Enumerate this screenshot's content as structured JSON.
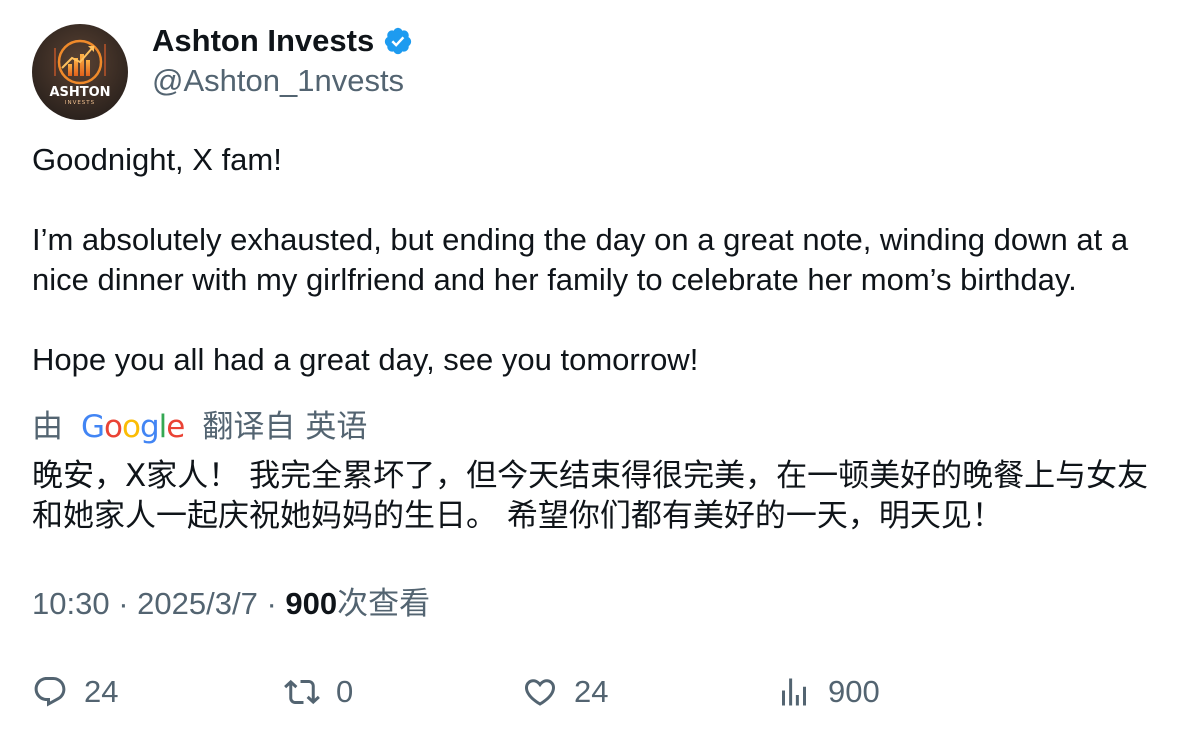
{
  "tweet": {
    "avatar": {
      "brand": "ASHTON",
      "sub": "INVESTS"
    },
    "display_name": "Ashton Invests",
    "handle": "@Ashton_1nvests",
    "verified_icon": "verified-badge-icon",
    "text_paragraphs": [
      "Goodnight, X fam!",
      "I’m absolutely exhausted, but ending the day on a great note, winding down at a nice dinner with my girlfriend and her family to celebrate her mom’s birthday.",
      "Hope you all had a great day, see you tomorrow!"
    ],
    "translation": {
      "prefix": "由",
      "provider": "Google",
      "action": "翻译自",
      "language": "英语",
      "text": "晚安，X家人！ 我完全累坏了，但今天结束得很完美，在一顿美好的晚餐上与女友和她家人一起庆祝她妈妈的生日。 希望你们都有美好的一天，明天见！"
    },
    "meta": {
      "time": "10:30",
      "separator": "·",
      "date": "2025/3/7",
      "views_count": "900",
      "views_label": "次查看"
    },
    "actions": {
      "reply": {
        "icon": "reply-icon",
        "count": "24"
      },
      "repost": {
        "icon": "repost-icon",
        "count": "0"
      },
      "like": {
        "icon": "heart-icon",
        "count": "24"
      },
      "views": {
        "icon": "analytics-icon",
        "count": "900"
      }
    },
    "colors": {
      "text_primary": "#0f1419",
      "text_secondary": "#536471",
      "verified_blue": "#1d9bf0",
      "google_blue": "#4285f4",
      "google_red": "#ea4335",
      "google_yellow": "#fbbc05",
      "google_green": "#34a853"
    }
  }
}
